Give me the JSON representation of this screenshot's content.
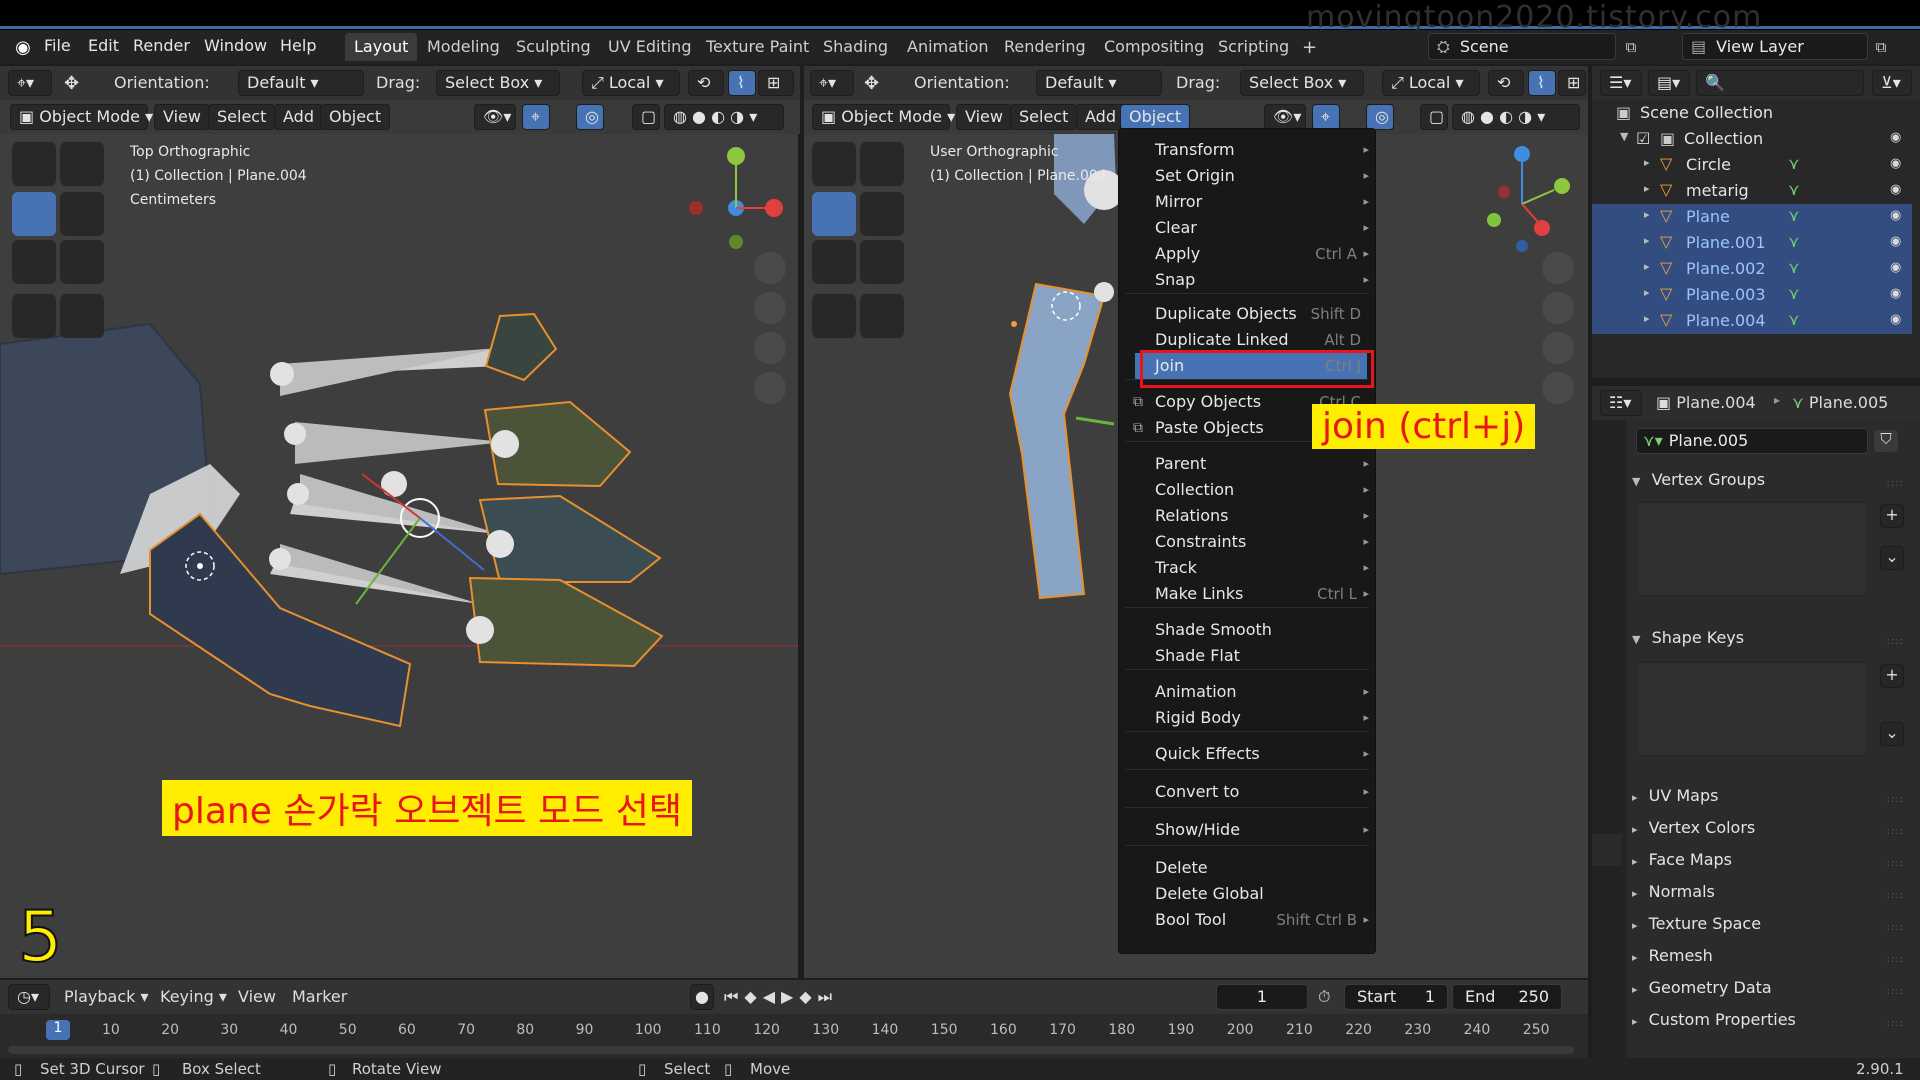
{
  "watermark": "movingtoon2020.tistory.com",
  "menubar": {
    "items": [
      "File",
      "Edit",
      "Render",
      "Window",
      "Help"
    ],
    "workspace_tabs": [
      "Layout",
      "Modeling",
      "Sculpting",
      "UV Editing",
      "Texture Paint",
      "Shading",
      "Animation",
      "Rendering",
      "Compositing",
      "Scripting"
    ],
    "add_tab": "+",
    "active_tab": "Layout",
    "scene": "Scene",
    "view_layer": "View Layer"
  },
  "left_view": {
    "orientation_label": "Orientation:",
    "orientation": "Default",
    "drag_label": "Drag:",
    "drag": "Select Box",
    "pivot": "Local",
    "mode": "Object Mode",
    "menus": [
      "View",
      "Select",
      "Add",
      "Object"
    ],
    "info_line1": "Top Orthographic",
    "info_line2": "(1) Collection | Plane.004",
    "info_line3": "Centimeters"
  },
  "right_view": {
    "orientation_label": "Orientation:",
    "orientation": "Default",
    "drag_label": "Drag:",
    "drag": "Select Box",
    "pivot": "Local",
    "mode": "Object Mode",
    "menus": [
      "View",
      "Select",
      "Add",
      "Object"
    ],
    "active_menu": "Object",
    "info_line1": "User Orthographic",
    "info_line2": "(1) Collection | Plane.004"
  },
  "object_menu": {
    "items": [
      {
        "label": "Transform",
        "shortcut": "",
        "submenu": true
      },
      {
        "label": "Set Origin",
        "shortcut": "",
        "submenu": true
      },
      {
        "label": "Mirror",
        "shortcut": "",
        "submenu": true
      },
      {
        "label": "Clear",
        "shortcut": "",
        "submenu": true
      },
      {
        "label": "Apply",
        "shortcut": "Ctrl A",
        "submenu": true
      },
      {
        "label": "Snap",
        "shortcut": "",
        "submenu": true
      },
      {
        "label": "Duplicate Objects",
        "shortcut": "Shift D",
        "submenu": false
      },
      {
        "label": "Duplicate Linked",
        "shortcut": "Alt D",
        "submenu": false
      },
      {
        "label": "Join",
        "shortcut": "Ctrl J",
        "submenu": false
      },
      {
        "label": "Copy Objects",
        "shortcut": "Ctrl C",
        "submenu": false
      },
      {
        "label": "Paste Objects",
        "shortcut": "",
        "submenu": false
      },
      {
        "label": "Parent",
        "shortcut": "",
        "submenu": true
      },
      {
        "label": "Collection",
        "shortcut": "",
        "submenu": true
      },
      {
        "label": "Relations",
        "shortcut": "",
        "submenu": true
      },
      {
        "label": "Constraints",
        "shortcut": "",
        "submenu": true
      },
      {
        "label": "Track",
        "shortcut": "",
        "submenu": true
      },
      {
        "label": "Make Links",
        "shortcut": "Ctrl L",
        "submenu": true
      },
      {
        "label": "Shade Smooth",
        "shortcut": "",
        "submenu": false
      },
      {
        "label": "Shade Flat",
        "shortcut": "",
        "submenu": false
      },
      {
        "label": "Animation",
        "shortcut": "",
        "submenu": true
      },
      {
        "label": "Rigid Body",
        "shortcut": "",
        "submenu": true
      },
      {
        "label": "Quick Effects",
        "shortcut": "",
        "submenu": true
      },
      {
        "label": "Convert to",
        "shortcut": "",
        "submenu": true
      },
      {
        "label": "Show/Hide",
        "shortcut": "",
        "submenu": true
      },
      {
        "label": "Delete",
        "shortcut": "",
        "submenu": false
      },
      {
        "label": "Delete Global",
        "shortcut": "",
        "submenu": false
      },
      {
        "label": "Bool Tool",
        "shortcut": "Shift Ctrl B",
        "submenu": true
      }
    ],
    "highlighted": "Join"
  },
  "annotations": {
    "join_note": "join  (ctrl+j)",
    "plane_note": "plane 손가락 오브젝트 모드 선택",
    "step_number": "5"
  },
  "outliner": {
    "root": "Scene Collection",
    "collection": "Collection",
    "objects": [
      {
        "name": "Circle",
        "selected": false
      },
      {
        "name": "metarig",
        "selected": false
      },
      {
        "name": "Plane",
        "selected": true
      },
      {
        "name": "Plane.001",
        "selected": true
      },
      {
        "name": "Plane.002",
        "selected": true
      },
      {
        "name": "Plane.003",
        "selected": true
      },
      {
        "name": "Plane.004",
        "selected": true
      }
    ]
  },
  "properties": {
    "breadcrumb_object": "Plane.004",
    "breadcrumb_mesh": "Plane.005",
    "mesh_name": "Plane.005",
    "panels": [
      "Vertex Groups",
      "Shape Keys"
    ],
    "collapsed_panels": [
      "UV Maps",
      "Vertex Colors",
      "Face Maps",
      "Normals",
      "Texture Space",
      "Remesh",
      "Geometry Data",
      "Custom Properties"
    ]
  },
  "timeline": {
    "menus": [
      "Playback",
      "Keying",
      "View",
      "Marker"
    ],
    "current_frame": "1",
    "start_label": "Start",
    "start": "1",
    "end_label": "End",
    "end": "250",
    "ticks": [
      "10",
      "20",
      "30",
      "40",
      "50",
      "60",
      "70",
      "80",
      "90",
      "100",
      "110",
      "120",
      "130",
      "140",
      "150",
      "160",
      "170",
      "180",
      "190",
      "200",
      "210",
      "220",
      "230",
      "240",
      "250"
    ],
    "playhead": "1"
  },
  "statusbar": {
    "items": [
      "Set 3D Cursor",
      "Box Select",
      "Rotate View",
      "Select",
      "Move"
    ],
    "version": "2.90.1"
  },
  "colors": {
    "accent": "#4772b3",
    "highlight_box": "#e8151b",
    "note_bg": "#ffee00"
  }
}
